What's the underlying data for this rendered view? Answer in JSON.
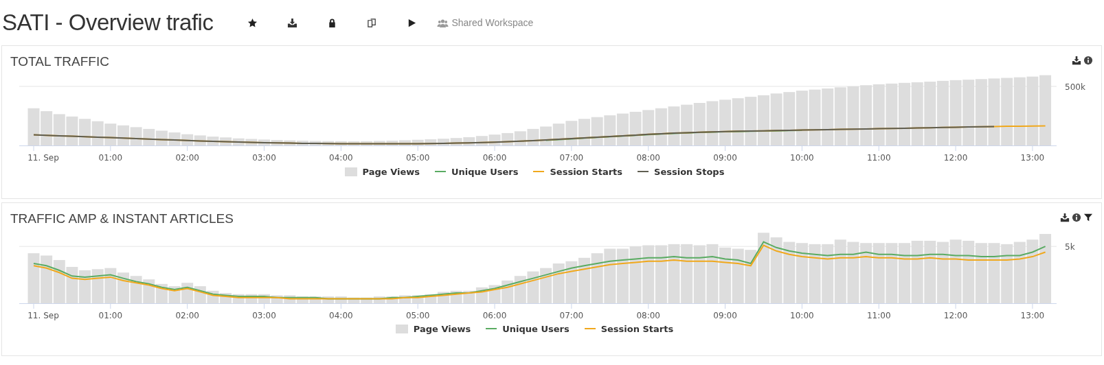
{
  "header": {
    "title": "SATI - Overview trafic",
    "actions": [
      {
        "kind": "star"
      },
      {
        "kind": "download"
      },
      {
        "kind": "lock"
      },
      {
        "kind": "copy"
      },
      {
        "kind": "play"
      }
    ],
    "workspace": "Shared Workspace"
  },
  "panels": [
    {
      "title": "TOTAL TRAFFIC",
      "tools": [
        {
          "kind": "download"
        },
        {
          "kind": "info"
        }
      ],
      "chart": {
        "y_label": "500k",
        "x_labels": [
          "11. Sep",
          "01:00",
          "02:00",
          "03:00",
          "04:00",
          "05:00",
          "06:00",
          "07:00",
          "08:00",
          "09:00",
          "10:00",
          "11:00",
          "12:00",
          "13:00"
        ],
        "legend": [
          {
            "name": "Page Views",
            "kind": "bar",
            "color": "#dddddd"
          },
          {
            "name": "Unique Users",
            "kind": "line",
            "color": "#5aab62"
          },
          {
            "name": "Session Starts",
            "kind": "line",
            "color": "#f0a81c"
          },
          {
            "name": "Session Stops",
            "kind": "line",
            "color": "#5f5e52"
          }
        ]
      }
    },
    {
      "title": "TRAFFIC AMP & INSTANT ARTICLES",
      "tools": [
        {
          "kind": "download"
        },
        {
          "kind": "info"
        },
        {
          "kind": "filter"
        }
      ],
      "chart": {
        "y_label": "5k",
        "x_labels": [
          "11. Sep",
          "01:00",
          "02:00",
          "03:00",
          "04:00",
          "05:00",
          "06:00",
          "07:00",
          "08:00",
          "09:00",
          "10:00",
          "11:00",
          "12:00",
          "13:00"
        ],
        "legend": [
          {
            "name": "Page Views",
            "kind": "bar",
            "color": "#dddddd"
          },
          {
            "name": "Unique Users",
            "kind": "line",
            "color": "#5aab62"
          },
          {
            "name": "Session Starts",
            "kind": "line",
            "color": "#f0a81c"
          }
        ]
      }
    }
  ]
}
